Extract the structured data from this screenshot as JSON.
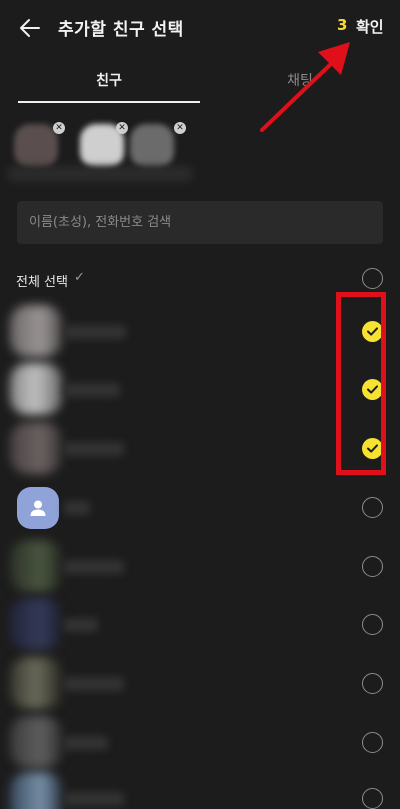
{
  "header": {
    "title": "추가할 친구 선택",
    "selected_count": "3",
    "confirm_label": "확인"
  },
  "tabs": [
    {
      "label": "친구",
      "active": true
    },
    {
      "label": "채팅",
      "active": false
    }
  ],
  "search": {
    "placeholder": "이름(초성), 전화번호 검색"
  },
  "select_all": {
    "label": "전체 선택",
    "checked": false
  },
  "friends": [
    {
      "checked": true,
      "avatar": "blurred-photo"
    },
    {
      "checked": true,
      "avatar": "blurred-photo"
    },
    {
      "checked": true,
      "avatar": "blurred-photo"
    },
    {
      "checked": false,
      "avatar": "default-profile-icon"
    },
    {
      "checked": false,
      "avatar": "blurred-photo"
    },
    {
      "checked": false,
      "avatar": "blurred-photo"
    },
    {
      "checked": false,
      "avatar": "blurred-photo"
    },
    {
      "checked": false,
      "avatar": "blurred-photo"
    },
    {
      "checked": false,
      "avatar": "blurred-photo"
    }
  ],
  "colors": {
    "background": "#1c1c1c",
    "accent_yellow": "#f8e231",
    "count_yellow": "#f7d83a",
    "annotation_red": "#e0101a"
  }
}
